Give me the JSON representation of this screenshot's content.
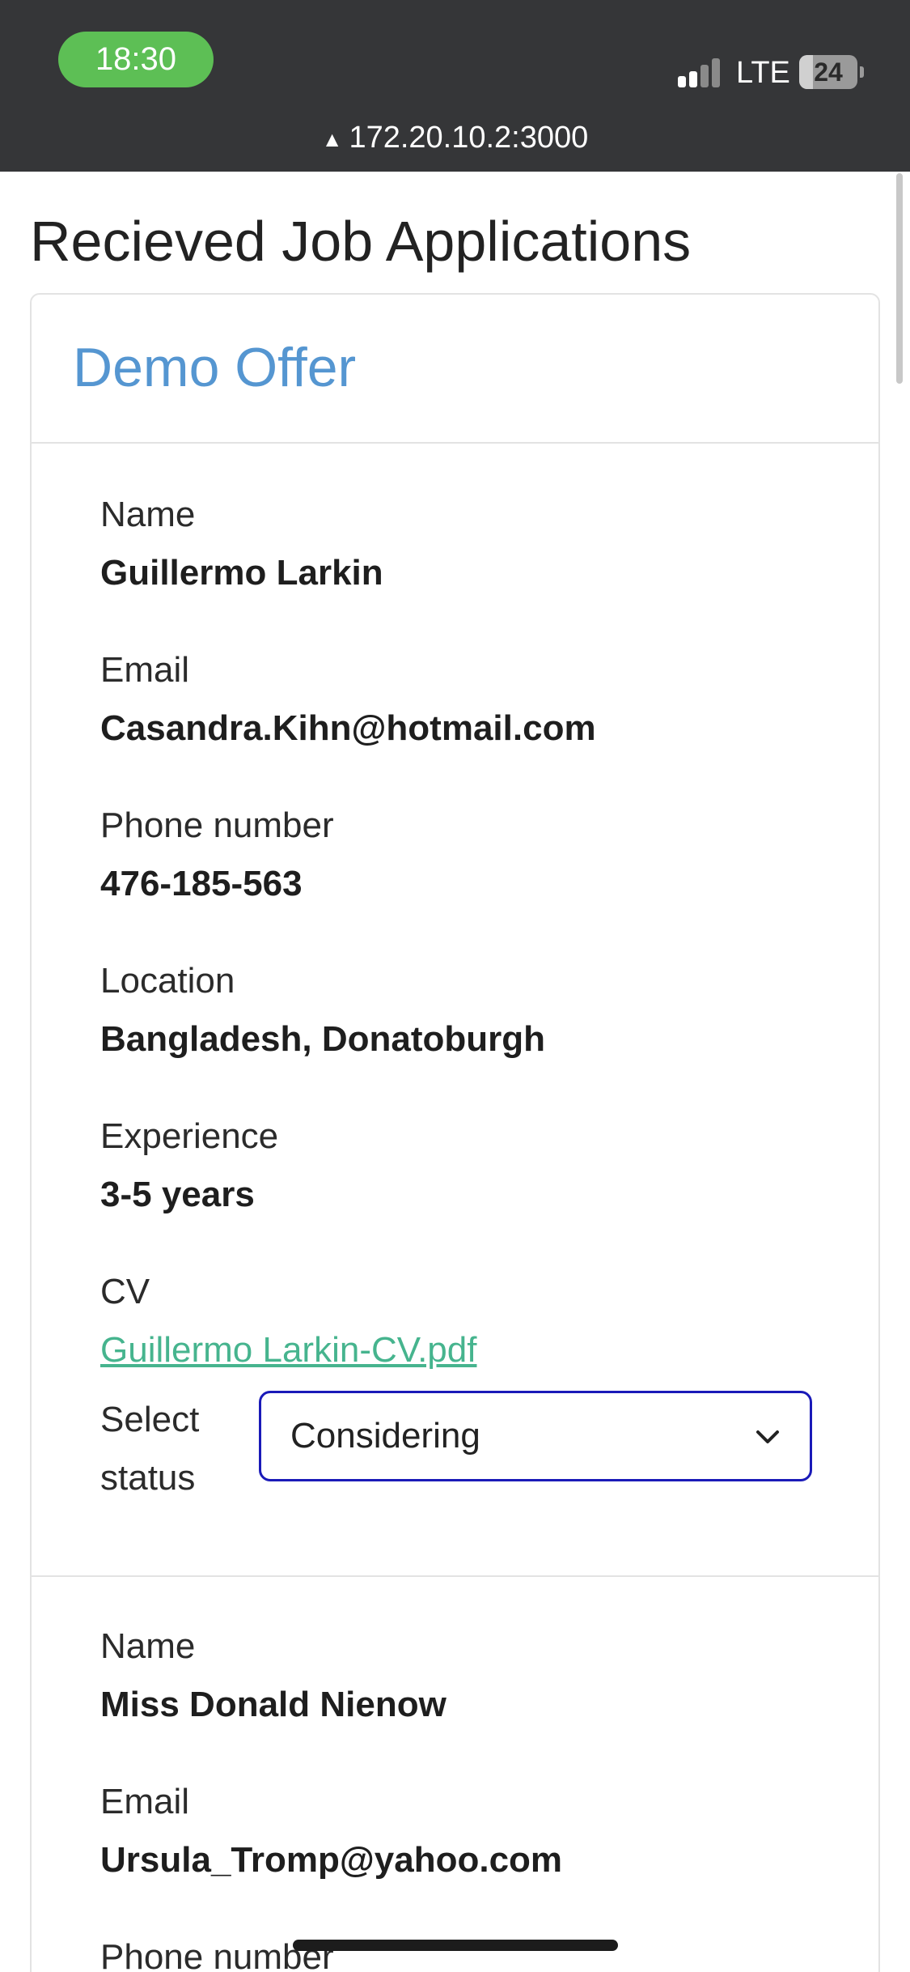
{
  "status_bar": {
    "time": "18:30",
    "network": "LTE",
    "battery": "24",
    "battery_level": 0.24,
    "url": "172.20.10.2:3000",
    "signal_icon": "signal-bars-icon",
    "warning_icon": "not-secure-warning-icon"
  },
  "page": {
    "title": "Recieved Job Applications"
  },
  "offer": {
    "title": "Demo Offer"
  },
  "applicants": [
    {
      "name_label": "Name",
      "name": "Guillermo Larkin",
      "email_label": "Email",
      "email": "Casandra.Kihn@hotmail.com",
      "phone_label": "Phone number",
      "phone": "476-185-563",
      "location_label": "Location",
      "location": "Bangladesh, Donatoburgh",
      "experience_label": "Experience",
      "experience": "3-5 years",
      "cv_label": "CV",
      "cv_link": "Guillermo Larkin-CV.pdf",
      "status_label": "Select status",
      "status": "Considering"
    },
    {
      "name_label": "Name",
      "name": "Miss Donald Nienow",
      "email_label": "Email",
      "email": "Ursula_Tromp@yahoo.com",
      "phone_label": "Phone number"
    }
  ],
  "colors": {
    "status_bar_bg": "#353638",
    "time_pill": "#5dbf55",
    "card_title": "#5596d1",
    "link": "#46b48e",
    "select_border": "#1a1ab8"
  }
}
